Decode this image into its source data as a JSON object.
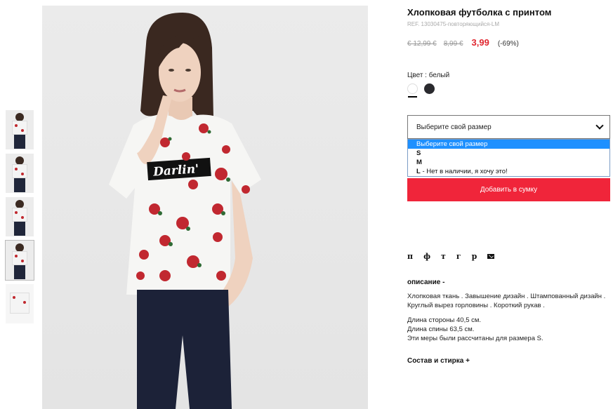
{
  "product": {
    "title": "Хлопковая футболка с принтом",
    "ref": "REF. 13030475-повторяющийся-LM",
    "price_original": "€ 12,99 €",
    "price_previous": "8,99 €",
    "price_sale": "3,99",
    "discount": "(-69%)",
    "shirt_print_text": "Darlin'"
  },
  "color": {
    "label": "Цвет : белый",
    "swatches": [
      {
        "name": "белый",
        "hex": "#ffffff"
      },
      {
        "name": "dark",
        "hex": "#2a2a2e"
      }
    ]
  },
  "size_select": {
    "placeholder": "Выберите свой размер",
    "options": [
      {
        "label": "Выберите свой размер",
        "note": ""
      },
      {
        "label": "S",
        "note": ""
      },
      {
        "label": "M",
        "note": ""
      },
      {
        "label": "L",
        "note": " - Нет в наличии, я хочу это!"
      }
    ]
  },
  "actions": {
    "add_to_bag": "Добавить в сумку"
  },
  "social": [
    "п",
    "ф",
    "т",
    "г",
    "р"
  ],
  "description": {
    "heading": "описание -",
    "text": "Хлопковая ткань . Завышение дизайн . Штампованный дизайн . Круглый вырез горловины . Короткий рукав .",
    "side_length": "Длина стороны 40,5 см.",
    "back_length": "Длина спины 63,5 см.",
    "note": "Эти меры были рассчитаны для размера S."
  },
  "care": {
    "heading": "Состав и стирка +"
  },
  "colors": {
    "accent": "#f0253a",
    "sale_price": "#e0262f",
    "dropdown_highlight": "#1e90ff"
  }
}
